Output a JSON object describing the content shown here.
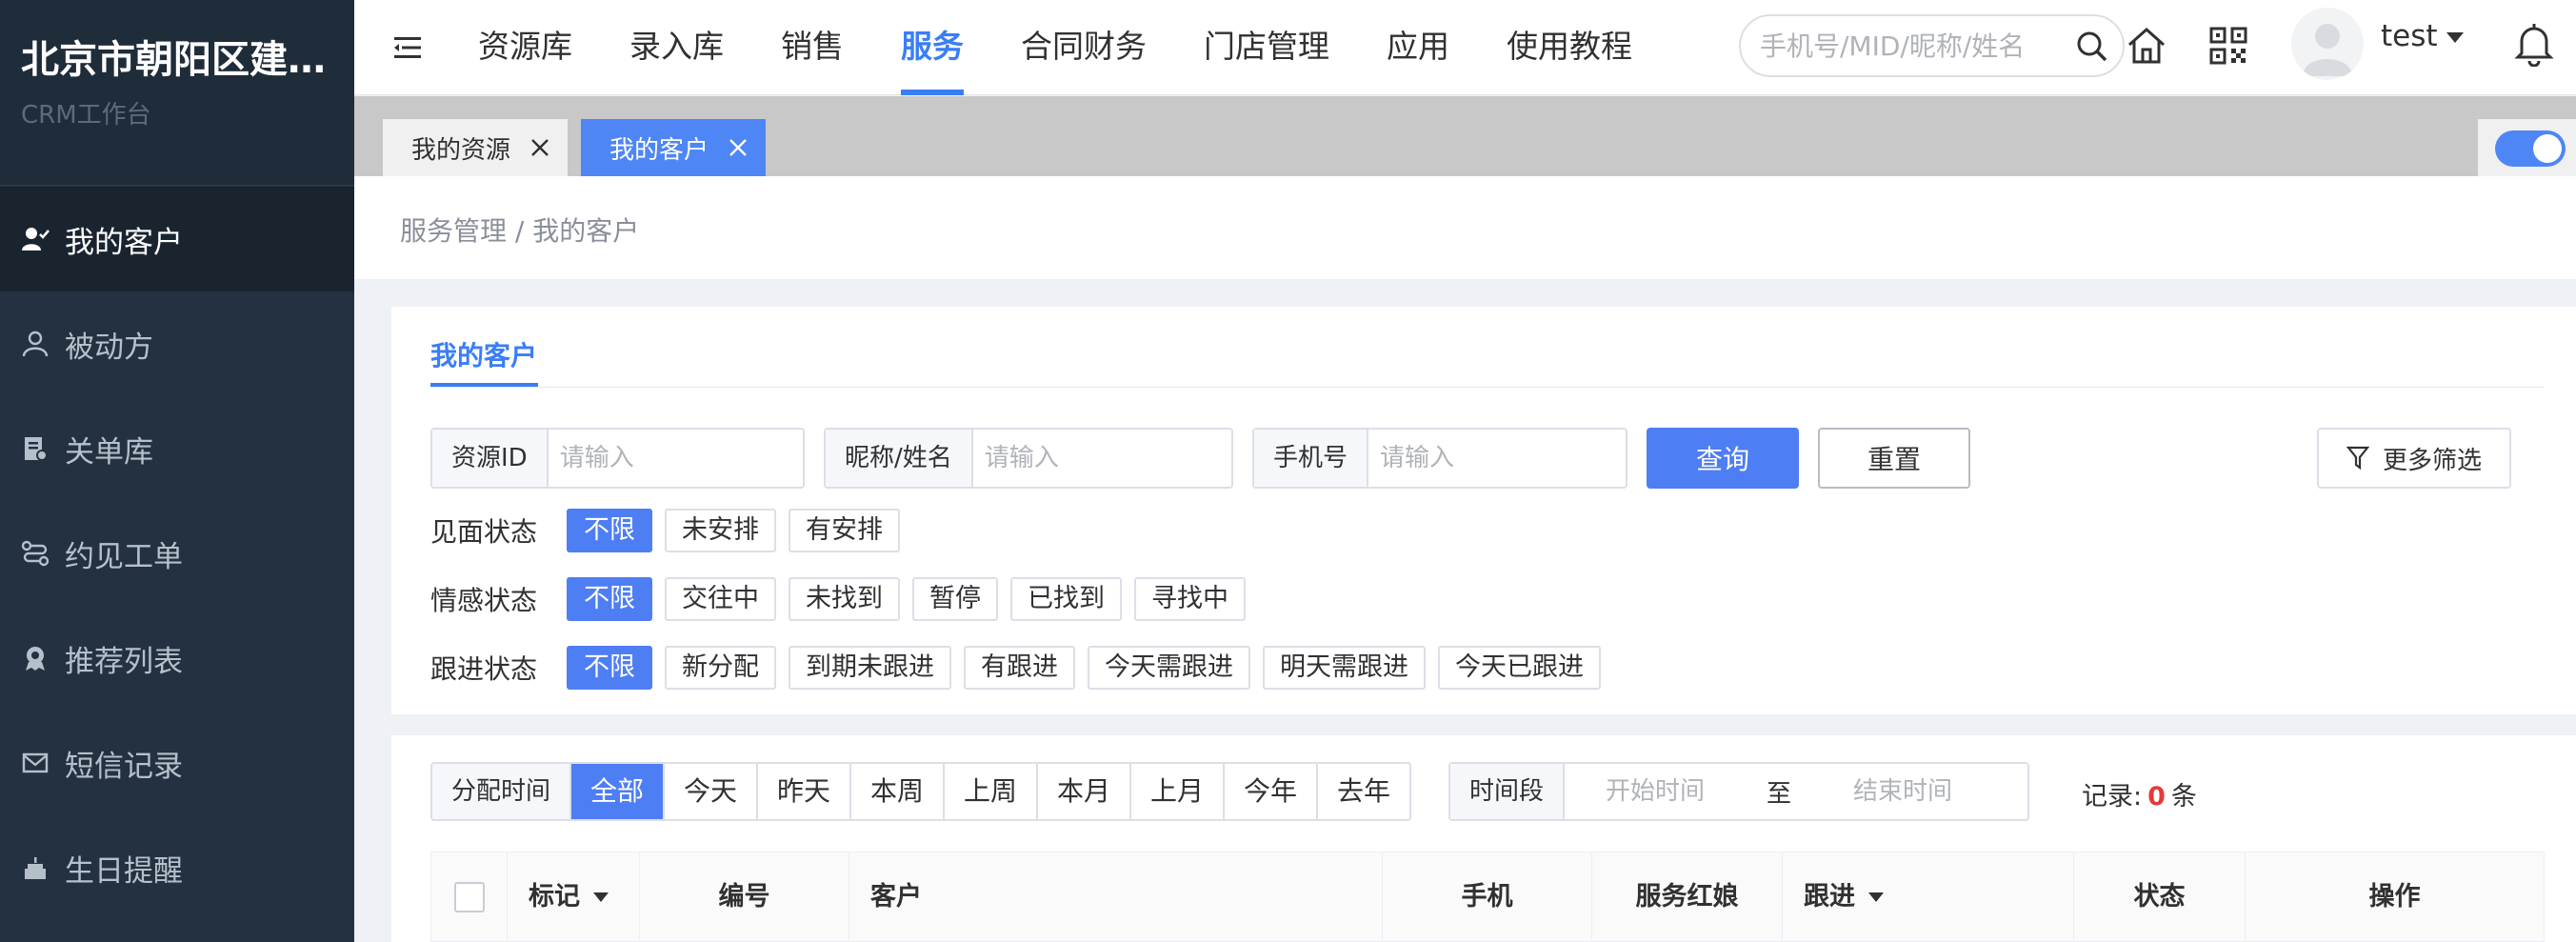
{
  "brand": {
    "title": "北京市朝阳区建设路店",
    "subtitle": "CRM工作台"
  },
  "sidebar": {
    "items": [
      {
        "label": "我的客户",
        "icon": "user-icon",
        "active": true
      },
      {
        "label": "被动方",
        "icon": "person-icon"
      },
      {
        "label": "关单库",
        "icon": "document-icon"
      },
      {
        "label": "约见工单",
        "icon": "route-icon"
      },
      {
        "label": "推荐列表",
        "icon": "badge-icon"
      },
      {
        "label": "短信记录",
        "icon": "mail-icon"
      },
      {
        "label": "生日提醒",
        "icon": "cake-icon"
      }
    ]
  },
  "topnav": {
    "items": [
      "资源库",
      "录入库",
      "销售",
      "服务",
      "合同财务",
      "门店管理",
      "应用",
      "使用教程"
    ],
    "active": "服务",
    "search_placeholder": "手机号/MID/昵称/姓名",
    "user_name": "test"
  },
  "tabs": [
    {
      "label": "我的资源",
      "active": false
    },
    {
      "label": "我的客户",
      "active": true
    }
  ],
  "breadcrumb": {
    "parent": "服务管理",
    "separator": " / ",
    "current": "我的客户"
  },
  "filter": {
    "title": "我的客户",
    "fields": [
      {
        "label": "资源ID",
        "placeholder": "请输入"
      },
      {
        "label": "昵称/姓名",
        "placeholder": "请输入"
      },
      {
        "label": "手机号",
        "placeholder": "请输入"
      }
    ],
    "query_label": "查询",
    "reset_label": "重置",
    "more_label": "更多筛选",
    "rows": [
      {
        "label": "见面状态",
        "options": [
          "不限",
          "未安排",
          "有安排"
        ],
        "active": 0
      },
      {
        "label": "情感状态",
        "options": [
          "不限",
          "交往中",
          "未找到",
          "暂停",
          "已找到",
          "寻找中"
        ],
        "active": 0
      },
      {
        "label": "跟进状态",
        "options": [
          "不限",
          "新分配",
          "到期未跟进",
          "有跟进",
          "今天需跟进",
          "明天需跟进",
          "今天已跟进"
        ],
        "active": 0
      }
    ]
  },
  "table_section": {
    "assign_label": "分配时间",
    "time_options": [
      "全部",
      "今天",
      "昨天",
      "本周",
      "上周",
      "本月",
      "上月",
      "今年",
      "去年"
    ],
    "time_active": 0,
    "range_label": "时间段",
    "start_placeholder": "开始时间",
    "range_sep": "至",
    "end_placeholder": "结束时间",
    "records_prefix": "记录:",
    "records_count": "0",
    "records_suffix": "条",
    "columns": [
      "标记",
      "编号",
      "客户",
      "手机",
      "服务红娘",
      "跟进",
      "状态",
      "操作"
    ]
  },
  "colors": {
    "accent": "#3a7ef7",
    "primary_button": "#4e7ef4",
    "sidebar_bg": "#243140",
    "count_red": "#e23b3b"
  }
}
